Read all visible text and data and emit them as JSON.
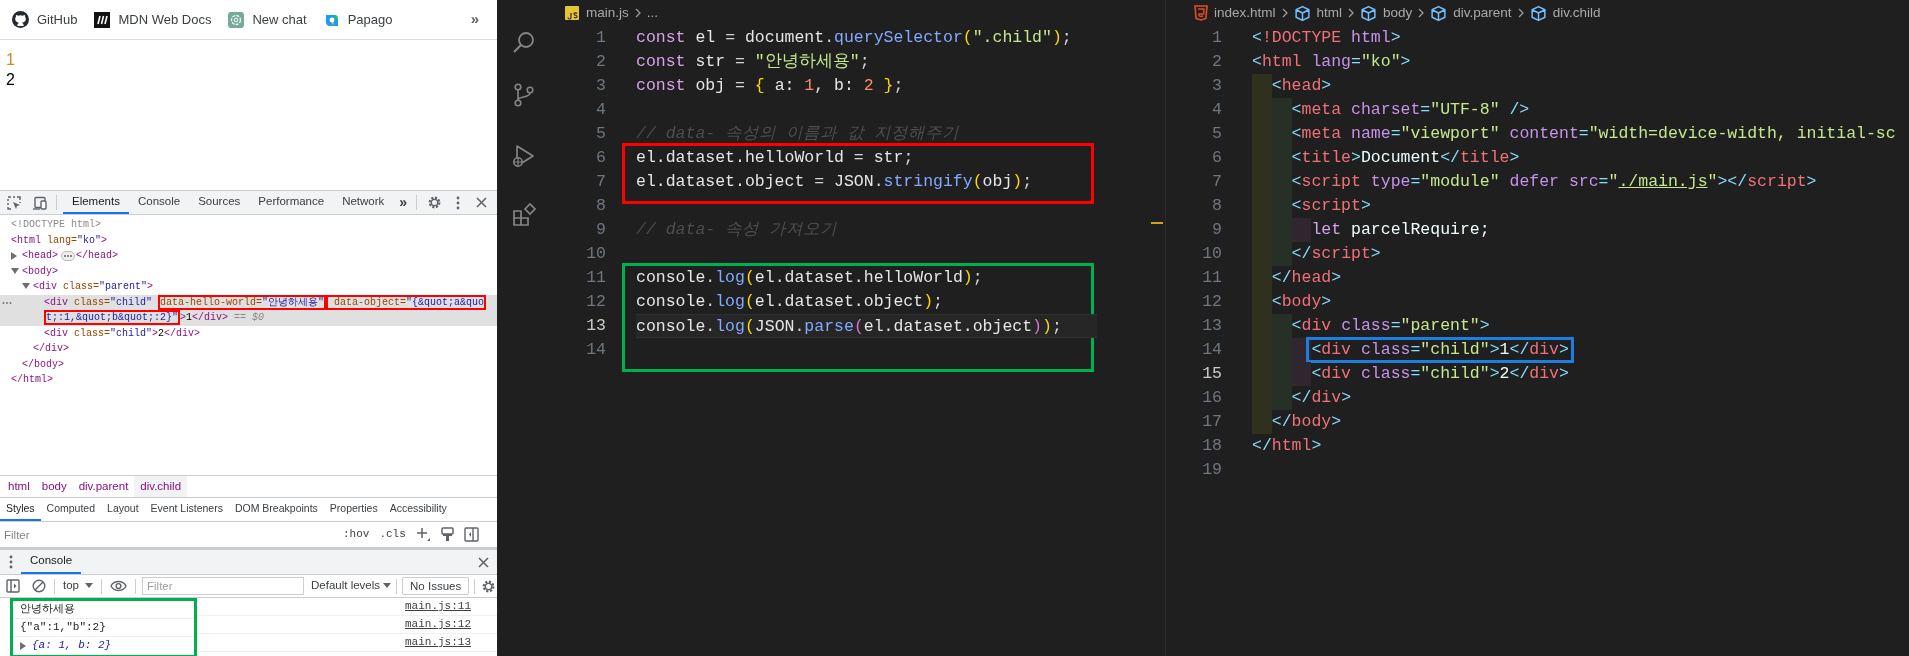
{
  "browser": {
    "bookmarks": [
      {
        "kind": "github",
        "label": "GitHub"
      },
      {
        "kind": "mdn",
        "label": "MDN Web Docs"
      },
      {
        "kind": "chat",
        "label": "New chat"
      },
      {
        "kind": "papago",
        "label": "Papago"
      }
    ],
    "more": "»",
    "page_lines": [
      {
        "text": "1",
        "color": "#d08a1e"
      },
      {
        "text": "2",
        "color": "#000000"
      }
    ]
  },
  "devtools": {
    "tabs": [
      {
        "label": "Elements",
        "selected": true
      },
      {
        "label": "Console",
        "selected": false
      },
      {
        "label": "Sources",
        "selected": false
      },
      {
        "label": "Performance",
        "selected": false
      },
      {
        "label": "Network",
        "selected": false
      }
    ],
    "more": "»",
    "dom_tree": [
      {
        "selected": false,
        "tokens": [
          {
            "kind": "doctype",
            "text": "<!DOCTYPE html>"
          }
        ]
      },
      {
        "selected": false,
        "tokens": [
          {
            "kind": "tag",
            "text": "<html"
          },
          {
            "kind": "attr",
            "text": " lang="
          },
          {
            "kind": "value",
            "text": "\"ko\""
          },
          {
            "kind": "tag",
            "text": ">"
          }
        ],
        "close": [
          {
            "kind": "tag",
            "text": "</html>"
          }
        ],
        "children": [
          {
            "selected": false,
            "expanded": false,
            "tokens": [
              {
                "kind": "tag",
                "text": "<head>"
              }
            ],
            "close": [
              {
                "kind": "tag",
                "text": "</head>"
              }
            ]
          },
          {
            "selected": false,
            "expanded": true,
            "tokens": [
              {
                "kind": "tag",
                "text": "<body>"
              }
            ],
            "close": [
              {
                "kind": "tag",
                "text": "</body>"
              }
            ],
            "children": [
              {
                "selected": false,
                "expanded": true,
                "tokens": [
                  {
                    "kind": "tag",
                    "text": "<div"
                  },
                  {
                    "kind": "attr",
                    "text": " class="
                  },
                  {
                    "kind": "value",
                    "text": "\"parent\""
                  },
                  {
                    "kind": "tag",
                    "text": ">"
                  }
                ],
                "close": [
                  {
                    "kind": "tag",
                    "text": "</div>"
                  }
                ],
                "children": [
                  {
                    "selected": true,
                    "tokens": [
                      {
                        "kind": "tag",
                        "text": "<div"
                      },
                      {
                        "kind": "attr",
                        "text": " class="
                      },
                      {
                        "kind": "value",
                        "text": "\"child\" "
                      },
                      {
                        "kind": "framed",
                        "color": "#ff0000",
                        "tokens": [
                          {
                            "kind": "attr",
                            "text": "data-hello-world="
                          },
                          {
                            "kind": "value",
                            "text": "\"안녕하세용\""
                          }
                        ]
                      },
                      {
                        "kind": "framed",
                        "color": "#ff0000",
                        "tokens": [
                          {
                            "kind": "attr",
                            "text": " data-object="
                          },
                          {
                            "kind": "value",
                            "text": "\"{&quot;a&quot;:1,&quot;b&quot;:2}\""
                          }
                        ]
                      },
                      {
                        "kind": "tag",
                        "text": ">"
                      },
                      {
                        "kind": "text",
                        "text": "1"
                      },
                      {
                        "kind": "tag",
                        "text": "</div>"
                      },
                      {
                        "kind": "hint",
                        "text": " == $0"
                      }
                    ]
                  },
                  {
                    "selected": false,
                    "tokens": [
                      {
                        "kind": "tag",
                        "text": "<div"
                      },
                      {
                        "kind": "attr",
                        "text": " class="
                      },
                      {
                        "kind": "value",
                        "text": "\"child\""
                      },
                      {
                        "kind": "tag",
                        "text": ">"
                      },
                      {
                        "kind": "text",
                        "text": "2"
                      },
                      {
                        "kind": "tag",
                        "text": "</div>"
                      }
                    ]
                  }
                ]
              }
            ]
          }
        ]
      }
    ],
    "breadcrumbs": [
      {
        "label": "html",
        "selected": false
      },
      {
        "label": "body",
        "selected": false
      },
      {
        "label": "div.parent",
        "selected": false
      },
      {
        "label": "div.child",
        "selected": true
      }
    ],
    "style_tabs": [
      {
        "label": "Styles",
        "selected": true
      },
      {
        "label": "Computed",
        "selected": false
      },
      {
        "label": "Layout",
        "selected": false
      },
      {
        "label": "Event Listeners",
        "selected": false
      },
      {
        "label": "DOM Breakpoints",
        "selected": false
      },
      {
        "label": "Properties",
        "selected": false
      },
      {
        "label": "Accessibility",
        "selected": false
      }
    ],
    "styles_filter": {
      "placeholder": "Filter"
    },
    "style_buttons": [
      ":hov",
      ".cls"
    ],
    "drawer_tabs": [
      {
        "label": "Console",
        "selected": true
      }
    ],
    "console": {
      "context": "top",
      "filter": {
        "placeholder": "Filter"
      },
      "levels": "Default levels",
      "issues": "No Issues",
      "frame": {
        "color": "#00b050"
      },
      "messages": [
        {
          "kind": "text",
          "text": "안녕하세용",
          "source": "main.js:11"
        },
        {
          "kind": "text",
          "text": "{\"a\":1,\"b\":2}",
          "source": "main.js:12"
        },
        {
          "kind": "object",
          "expanded": false,
          "text": "{a: 1, b: 2}",
          "source": "main.js:13"
        }
      ]
    }
  },
  "editors": [
    {
      "focused": true,
      "breadcrumb": [
        {
          "kind": "js-file",
          "label": "main.js"
        },
        {
          "kind": "more",
          "label": "..."
        }
      ],
      "lines": [
        {
          "number": "1",
          "current": false,
          "tokens": [
            {
              "kind": "kw",
              "text": "const"
            },
            {
              "kind": "var",
              "text": " el "
            },
            {
              "kind": "op",
              "text": "= "
            },
            {
              "kind": "var",
              "text": "document"
            },
            {
              "kind": "op",
              "text": "."
            },
            {
              "kind": "fn",
              "text": "querySelector"
            },
            {
              "kind": "b1",
              "text": "("
            },
            {
              "kind": "str",
              "text": "\".child\""
            },
            {
              "kind": "b1",
              "text": ")"
            },
            {
              "kind": "op",
              "text": ";"
            }
          ]
        },
        {
          "number": "2",
          "current": false,
          "tokens": [
            {
              "kind": "kw",
              "text": "const"
            },
            {
              "kind": "var",
              "text": " str "
            },
            {
              "kind": "op",
              "text": "= "
            },
            {
              "kind": "str",
              "text": "\"안녕하세용\""
            },
            {
              "kind": "op",
              "text": ";"
            }
          ]
        },
        {
          "number": "3",
          "current": false,
          "tokens": [
            {
              "kind": "kw",
              "text": "const"
            },
            {
              "kind": "var",
              "text": " obj "
            },
            {
              "kind": "op",
              "text": "= "
            },
            {
              "kind": "b1",
              "text": "{"
            },
            {
              "kind": "var",
              "text": " a: "
            },
            {
              "kind": "num",
              "text": "1"
            },
            {
              "kind": "var",
              "text": ", b: "
            },
            {
              "kind": "num",
              "text": "2"
            },
            {
              "kind": "b1",
              "text": " }"
            },
            {
              "kind": "op",
              "text": ";"
            }
          ]
        },
        {
          "number": "4",
          "current": false
        },
        {
          "number": "5",
          "current": false,
          "tokens": [
            {
              "kind": "cm",
              "text": "// data- 속성의 이름과 값 지정해주기"
            }
          ]
        },
        {
          "number": "6",
          "current": false,
          "frame": {
            "color": "#ff0000"
          },
          "tokens": [
            {
              "kind": "var",
              "text": "el.dataset.helloWorld "
            },
            {
              "kind": "op",
              "text": "= "
            },
            {
              "kind": "var",
              "text": "str"
            },
            {
              "kind": "op",
              "text": ";"
            }
          ]
        },
        {
          "number": "7",
          "current": false,
          "frame": {
            "color": "#ff0000"
          },
          "tokens": [
            {
              "kind": "var",
              "text": "el.dataset.object "
            },
            {
              "kind": "op",
              "text": "= "
            },
            {
              "kind": "var",
              "text": "JSON"
            },
            {
              "kind": "op",
              "text": "."
            },
            {
              "kind": "fn",
              "text": "stringify"
            },
            {
              "kind": "b1",
              "text": "("
            },
            {
              "kind": "var",
              "text": "obj"
            },
            {
              "kind": "b1",
              "text": ")"
            },
            {
              "kind": "op",
              "text": ";"
            }
          ]
        },
        {
          "number": "8",
          "current": false
        },
        {
          "number": "9",
          "current": false,
          "tokens": [
            {
              "kind": "cm",
              "text": "// data- 속성 가져오기"
            }
          ]
        },
        {
          "number": "10",
          "current": false
        },
        {
          "number": "11",
          "current": false,
          "frame": {
            "color": "#00b050"
          },
          "tokens": [
            {
              "kind": "var",
              "text": "console"
            },
            {
              "kind": "op",
              "text": "."
            },
            {
              "kind": "fn",
              "text": "log"
            },
            {
              "kind": "b1",
              "text": "("
            },
            {
              "kind": "var",
              "text": "el.dataset.helloWorld"
            },
            {
              "kind": "b1",
              "text": ")"
            },
            {
              "kind": "op",
              "text": ";"
            }
          ]
        },
        {
          "number": "12",
          "current": false,
          "frame": {
            "color": "#00b050"
          },
          "tokens": [
            {
              "kind": "var",
              "text": "console"
            },
            {
              "kind": "op",
              "text": "."
            },
            {
              "kind": "fn",
              "text": "log"
            },
            {
              "kind": "b1",
              "text": "("
            },
            {
              "kind": "var",
              "text": "el.dataset.object"
            },
            {
              "kind": "b1",
              "text": ")"
            },
            {
              "kind": "op",
              "text": ";"
            }
          ]
        },
        {
          "number": "13",
          "current": true,
          "frame": {
            "color": "#00b050"
          },
          "tokens": [
            {
              "kind": "var",
              "text": "console"
            },
            {
              "kind": "op",
              "text": "."
            },
            {
              "kind": "fn",
              "text": "log"
            },
            {
              "kind": "b1",
              "text": "("
            },
            {
              "kind": "var",
              "text": "JSON"
            },
            {
              "kind": "op",
              "text": "."
            },
            {
              "kind": "fn",
              "text": "parse"
            },
            {
              "kind": "b2",
              "text": "("
            },
            {
              "kind": "var",
              "text": "el.dataset.object"
            },
            {
              "kind": "b2",
              "text": ")"
            },
            {
              "kind": "b1",
              "text": ")"
            },
            {
              "kind": "op",
              "text": ";"
            }
          ]
        },
        {
          "number": "14",
          "current": false,
          "frame": {
            "color": "#00b050"
          }
        }
      ]
    },
    {
      "focused": false,
      "breadcrumb": [
        {
          "kind": "html-file",
          "label": "index.html"
        },
        {
          "kind": "element",
          "label": "html"
        },
        {
          "kind": "element",
          "label": "body"
        },
        {
          "kind": "element",
          "label": "div.parent"
        },
        {
          "kind": "element",
          "label": "div.child"
        }
      ],
      "lines": [
        {
          "number": "1",
          "current": false,
          "tokens": [
            {
              "kind": "tb",
              "text": "<"
            },
            {
              "kind": "tn",
              "text": "!DOCTYPE"
            },
            {
              "kind": "at",
              "text": " html"
            },
            {
              "kind": "tb",
              "text": ">"
            }
          ]
        },
        {
          "number": "2",
          "current": false,
          "tokens": [
            {
              "kind": "tb",
              "text": "<"
            },
            {
              "kind": "tn",
              "text": "html"
            },
            {
              "kind": "at",
              "text": " lang"
            },
            {
              "kind": "tb",
              "text": "="
            },
            {
              "kind": "hs",
              "text": "\"ko\""
            },
            {
              "kind": "tb",
              "text": ">"
            }
          ]
        },
        {
          "number": "3",
          "current": false,
          "tokens": [
            {
              "kind": "tb",
              "text": "  <"
            },
            {
              "kind": "tn",
              "text": "head"
            },
            {
              "kind": "tb",
              "text": ">"
            }
          ]
        },
        {
          "number": "4",
          "current": false,
          "tokens": [
            {
              "kind": "tb",
              "text": "    <"
            },
            {
              "kind": "tn",
              "text": "meta"
            },
            {
              "kind": "at",
              "text": " charset"
            },
            {
              "kind": "tb",
              "text": "="
            },
            {
              "kind": "hs",
              "text": "\"UTF-8\""
            },
            {
              "kind": "tb",
              "text": " />"
            }
          ]
        },
        {
          "number": "5",
          "current": false,
          "tokens": [
            {
              "kind": "tb",
              "text": "    <"
            },
            {
              "kind": "tn",
              "text": "meta"
            },
            {
              "kind": "at",
              "text": " name"
            },
            {
              "kind": "tb",
              "text": "="
            },
            {
              "kind": "hs",
              "text": "\"viewport\""
            },
            {
              "kind": "at",
              "text": " content"
            },
            {
              "kind": "tb",
              "text": "="
            },
            {
              "kind": "hs",
              "text": "\"width=device-width, initial-sc"
            }
          ]
        },
        {
          "number": "6",
          "current": false,
          "tokens": [
            {
              "kind": "tb",
              "text": "    <"
            },
            {
              "kind": "tn",
              "text": "title"
            },
            {
              "kind": "tb",
              "text": ">"
            },
            {
              "kind": "tx",
              "text": "Document"
            },
            {
              "kind": "tb",
              "text": "</"
            },
            {
              "kind": "tn",
              "text": "title"
            },
            {
              "kind": "tb",
              "text": ">"
            }
          ]
        },
        {
          "number": "7",
          "current": false,
          "tokens": [
            {
              "kind": "tb",
              "text": "    <"
            },
            {
              "kind": "tn",
              "text": "script"
            },
            {
              "kind": "at",
              "text": " type"
            },
            {
              "kind": "tb",
              "text": "="
            },
            {
              "kind": "hs",
              "text": "\"module\""
            },
            {
              "kind": "at",
              "text": " defer src"
            },
            {
              "kind": "tb",
              "text": "="
            },
            {
              "kind": "hs",
              "text": "\""
            },
            {
              "kind": "link",
              "text": "./main.js"
            },
            {
              "kind": "hs",
              "text": "\""
            },
            {
              "kind": "tb",
              "text": "></"
            },
            {
              "kind": "tn",
              "text": "script"
            },
            {
              "kind": "tb",
              "text": ">"
            }
          ]
        },
        {
          "number": "8",
          "current": false,
          "tokens": [
            {
              "kind": "tb",
              "text": "    <"
            },
            {
              "kind": "tn",
              "text": "script"
            },
            {
              "kind": "tb",
              "text": ">"
            }
          ]
        },
        {
          "number": "9",
          "current": false,
          "tokens": [
            {
              "kind": "kw",
              "text": "      let"
            },
            {
              "kind": "tx",
              "text": " parcelRequire;"
            }
          ]
        },
        {
          "number": "10",
          "current": false,
          "tokens": [
            {
              "kind": "tb",
              "text": "    </"
            },
            {
              "kind": "tn",
              "text": "script"
            },
            {
              "kind": "tb",
              "text": ">"
            }
          ]
        },
        {
          "number": "11",
          "current": false,
          "tokens": [
            {
              "kind": "tb",
              "text": "  </"
            },
            {
              "kind": "tn",
              "text": "head"
            },
            {
              "kind": "tb",
              "text": ">"
            }
          ]
        },
        {
          "number": "12",
          "current": false,
          "tokens": [
            {
              "kind": "tb",
              "text": "  <"
            },
            {
              "kind": "tn",
              "text": "body"
            },
            {
              "kind": "tb",
              "text": ">"
            }
          ]
        },
        {
          "number": "13",
          "current": false,
          "tokens": [
            {
              "kind": "tb",
              "text": "    <"
            },
            {
              "kind": "tn",
              "text": "div"
            },
            {
              "kind": "at",
              "text": " class"
            },
            {
              "kind": "tb",
              "text": "="
            },
            {
              "kind": "hs",
              "text": "\"parent\""
            },
            {
              "kind": "tb",
              "text": ">"
            }
          ]
        },
        {
          "number": "14",
          "current": false,
          "frame": {
            "color": "#1a7fe0"
          },
          "tokens": [
            {
              "kind": "tb",
              "text": "      <"
            },
            {
              "kind": "tn",
              "text": "div"
            },
            {
              "kind": "at",
              "text": " class"
            },
            {
              "kind": "tb",
              "text": "="
            },
            {
              "kind": "hs",
              "text": "\"child\""
            },
            {
              "kind": "tb",
              "text": ">"
            },
            {
              "kind": "tx",
              "text": "1"
            },
            {
              "kind": "tb",
              "text": "</"
            },
            {
              "kind": "tn",
              "text": "div"
            },
            {
              "kind": "tb",
              "text": ">"
            }
          ]
        },
        {
          "number": "15",
          "current": true,
          "tokens": [
            {
              "kind": "tb",
              "text": "      <"
            },
            {
              "kind": "tn",
              "text": "div"
            },
            {
              "kind": "at",
              "text": " class"
            },
            {
              "kind": "tb",
              "text": "="
            },
            {
              "kind": "hs",
              "text": "\"child\""
            },
            {
              "kind": "tb",
              "text": ">"
            },
            {
              "kind": "tx",
              "text": "2"
            },
            {
              "kind": "tb",
              "text": "</"
            },
            {
              "kind": "tn",
              "text": "div"
            },
            {
              "kind": "tb",
              "text": ">"
            }
          ]
        },
        {
          "number": "16",
          "current": false,
          "tokens": [
            {
              "kind": "tb",
              "text": "    </"
            },
            {
              "kind": "tn",
              "text": "div"
            },
            {
              "kind": "tb",
              "text": ">"
            }
          ]
        },
        {
          "number": "17",
          "current": false,
          "tokens": [
            {
              "kind": "tb",
              "text": "  </"
            },
            {
              "kind": "tn",
              "text": "body"
            },
            {
              "kind": "tb",
              "text": ">"
            }
          ]
        },
        {
          "number": "18",
          "current": false,
          "tokens": [
            {
              "kind": "tb",
              "text": "</"
            },
            {
              "kind": "tn",
              "text": "html"
            },
            {
              "kind": "tb",
              "text": ">"
            }
          ]
        },
        {
          "number": "19",
          "current": false
        }
      ]
    }
  ]
}
